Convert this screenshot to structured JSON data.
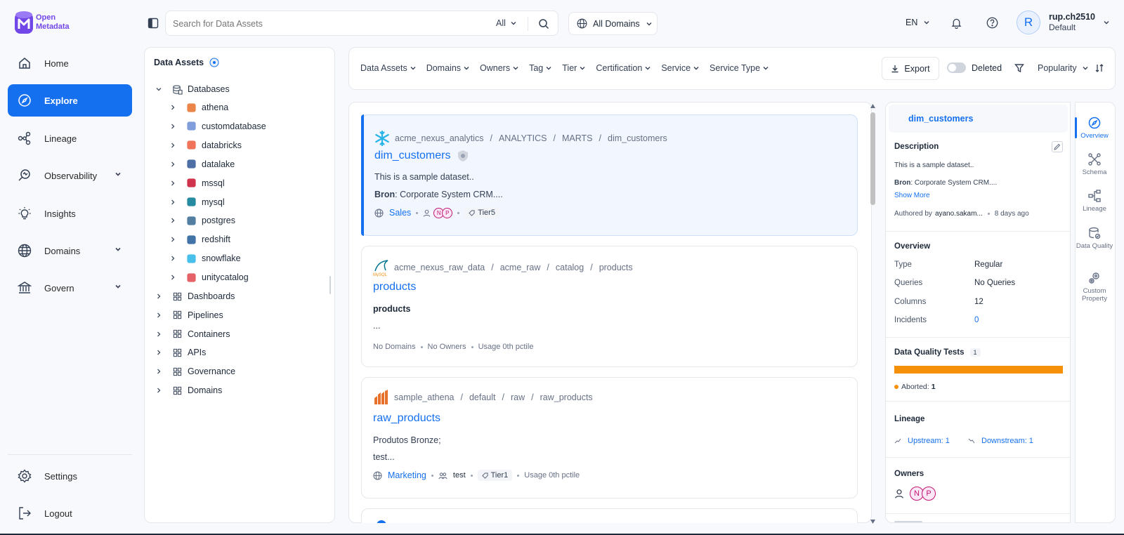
{
  "app": {
    "logo_line1": "Open",
    "logo_line2": "Metadata"
  },
  "header": {
    "search_placeholder": "Search for Data Assets",
    "search_scope": "All",
    "domain_select": "All Domains",
    "language": "EN",
    "user_name": "rup.ch2510",
    "user_role": "Default",
    "avatar_letter": "R"
  },
  "sidebar": {
    "items": [
      {
        "label": "Home",
        "icon": "home-icon"
      },
      {
        "label": "Explore",
        "icon": "compass-icon"
      },
      {
        "label": "Lineage",
        "icon": "lineage-icon"
      },
      {
        "label": "Observability",
        "icon": "observability-icon"
      },
      {
        "label": "Insights",
        "icon": "lightbulb-icon"
      },
      {
        "label": "Domains",
        "icon": "globe-icon"
      },
      {
        "label": "Govern",
        "icon": "bank-icon"
      }
    ],
    "settings": "Settings",
    "logout": "Logout"
  },
  "tree": {
    "title": "Data Assets",
    "databases_label": "Databases",
    "services": [
      "athena",
      "customdatabase",
      "databricks",
      "datalake",
      "mssql",
      "mysql",
      "postgres",
      "redshift",
      "snowflake",
      "unitycatalog"
    ],
    "groups": [
      "Dashboards",
      "Pipelines",
      "Containers",
      "APIs",
      "Governance",
      "Domains"
    ]
  },
  "filters": {
    "items": [
      "Data Assets",
      "Domains",
      "Owners",
      "Tag",
      "Tier",
      "Certification",
      "Service",
      "Service Type"
    ],
    "export": "Export",
    "deleted": "Deleted",
    "sort": "Popularity"
  },
  "results": [
    {
      "crumbs": [
        "acme_nexus_analytics",
        "ANALYTICS",
        "MARTS",
        "dim_customers"
      ],
      "title": "dim_customers",
      "line1": "This is a sample dataset..",
      "line2_bold": "Bron",
      "line2_rest": ": Corporate System CRM....",
      "domain": "Sales",
      "owners": [
        "N",
        "P"
      ],
      "tier": "Tier5"
    },
    {
      "crumbs": [
        "acme_nexus_raw_data",
        "acme_raw",
        "catalog",
        "products"
      ],
      "title": "products",
      "line1": "products",
      "line2": "...",
      "meta": [
        "No Domains",
        "No Owners",
        "Usage 0th pctile"
      ]
    },
    {
      "crumbs": [
        "sample_athena",
        "default",
        "raw",
        "raw_products"
      ],
      "title": "raw_products",
      "line1": "Produtos Bronze;",
      "line2": "test...",
      "domain": "Marketing",
      "owner": "test",
      "tier": "Tier1",
      "usage": "Usage 0th pctile"
    }
  ],
  "detail": {
    "title": "dim_customers",
    "description_heading": "Description",
    "desc_line1": "This is a sample dataset..",
    "desc_bold": "Bron",
    "desc_rest": ": Corporate System CRM....",
    "show_more": "Show More",
    "authored_by_label": "Authored by",
    "author": "ayano.sakam...",
    "authored_when": "8 days ago",
    "overview_heading": "Overview",
    "overview": [
      {
        "label": "Type",
        "value": "Regular"
      },
      {
        "label": "Queries",
        "value": "No Queries"
      },
      {
        "label": "Columns",
        "value": "12"
      },
      {
        "label": "Incidents",
        "value": "0"
      }
    ],
    "dq_heading": "Data Quality Tests",
    "dq_count": "1",
    "dq_status": "Aborted:",
    "dq_status_count": "1",
    "lineage_heading": "Lineage",
    "upstream": "Upstream:",
    "upstream_count": "1",
    "downstream": "Downstream:",
    "downstream_count": "1",
    "owners_heading": "Owners",
    "owners": [
      "N",
      "P"
    ]
  },
  "side_tabs": [
    {
      "label": "Overview"
    },
    {
      "label": "Schema"
    },
    {
      "label": "Lineage"
    },
    {
      "label": "Data Quality"
    },
    {
      "label": "Custom Property"
    }
  ],
  "colors": {
    "accent": "#1570ef",
    "aborted": "#f79009"
  }
}
